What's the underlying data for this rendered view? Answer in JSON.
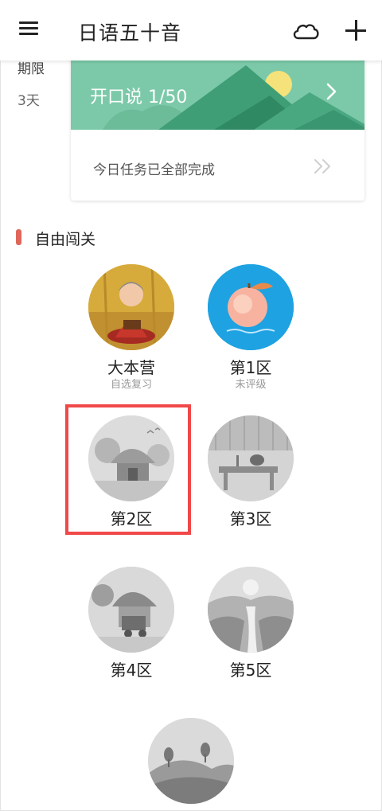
{
  "header": {
    "title": "日语五十音",
    "menu_icon": "menu-icon",
    "cloud_icon": "cloud-icon",
    "add_icon": "plus-icon"
  },
  "side_info": {
    "label": "期限",
    "value": "3天"
  },
  "speaking_card": {
    "banner_text": "开口说 1/50",
    "task_text": "今日任务已全部完成",
    "banner_color": "#7cc9a9"
  },
  "section": {
    "title": "自由闯关",
    "marker_color": "#e0665a"
  },
  "zones": [
    {
      "name": "大本营",
      "sub": "自选复习"
    },
    {
      "name": "第1区",
      "sub": "未评级"
    },
    {
      "name": "第2区",
      "sub": ""
    },
    {
      "name": "第3区",
      "sub": ""
    },
    {
      "name": "第4区",
      "sub": ""
    },
    {
      "name": "第5区",
      "sub": ""
    }
  ],
  "highlight_color": "#f04848"
}
